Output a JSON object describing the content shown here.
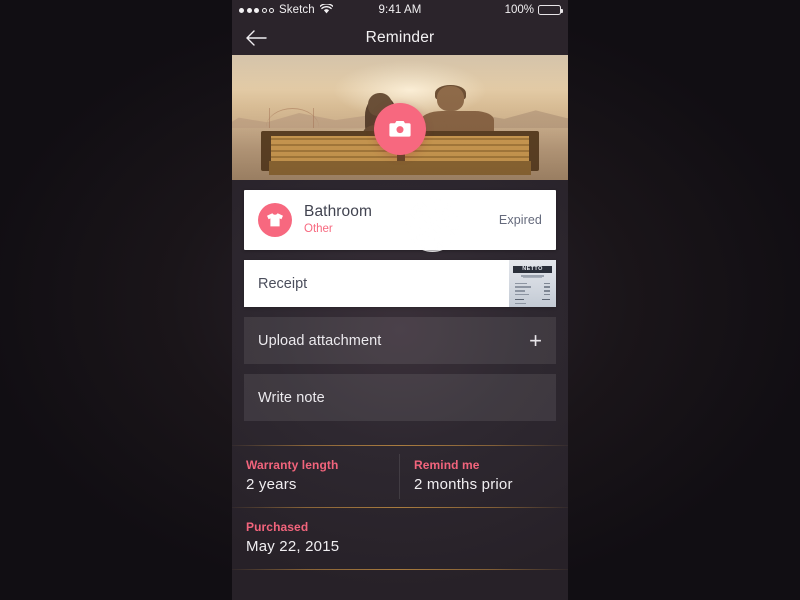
{
  "status_bar": {
    "carrier": "Sketch",
    "signal_dots_filled": 3,
    "signal_dots_empty": 2,
    "wifi_icon": "wifi-icon",
    "time": "9:41 AM",
    "battery_percent": "100%",
    "battery_level": 100
  },
  "navbar": {
    "back_icon": "arrow-left-icon",
    "title": "Reminder"
  },
  "hero": {
    "camera_icon": "camera-icon",
    "photo_alt": "Couple sitting on a bench by the bay at sunset"
  },
  "item_card": {
    "category_icon": "tshirt-icon",
    "title": "Bathroom",
    "subtitle": "Other",
    "status": "Expired"
  },
  "rows": {
    "receipt": {
      "label": "Receipt",
      "thumbnail_brand": "NETTO"
    },
    "upload": {
      "label": "Upload attachment",
      "action_icon": "plus-icon"
    },
    "note": {
      "label": "Write note"
    }
  },
  "details": [
    {
      "label": "Warranty length",
      "value": "2 years"
    },
    {
      "label": "Remind me",
      "value": "2 months prior"
    },
    {
      "label": "Purchased",
      "value": "May 22, 2015"
    }
  ],
  "colors": {
    "accent_pink": "#f7687f",
    "label_pink": "#f2647c",
    "screen_bg": "#2e2830",
    "navbar_bg": "#2b242b",
    "card_white": "#ffffff",
    "divider_amber": "#d6984 2"
  }
}
